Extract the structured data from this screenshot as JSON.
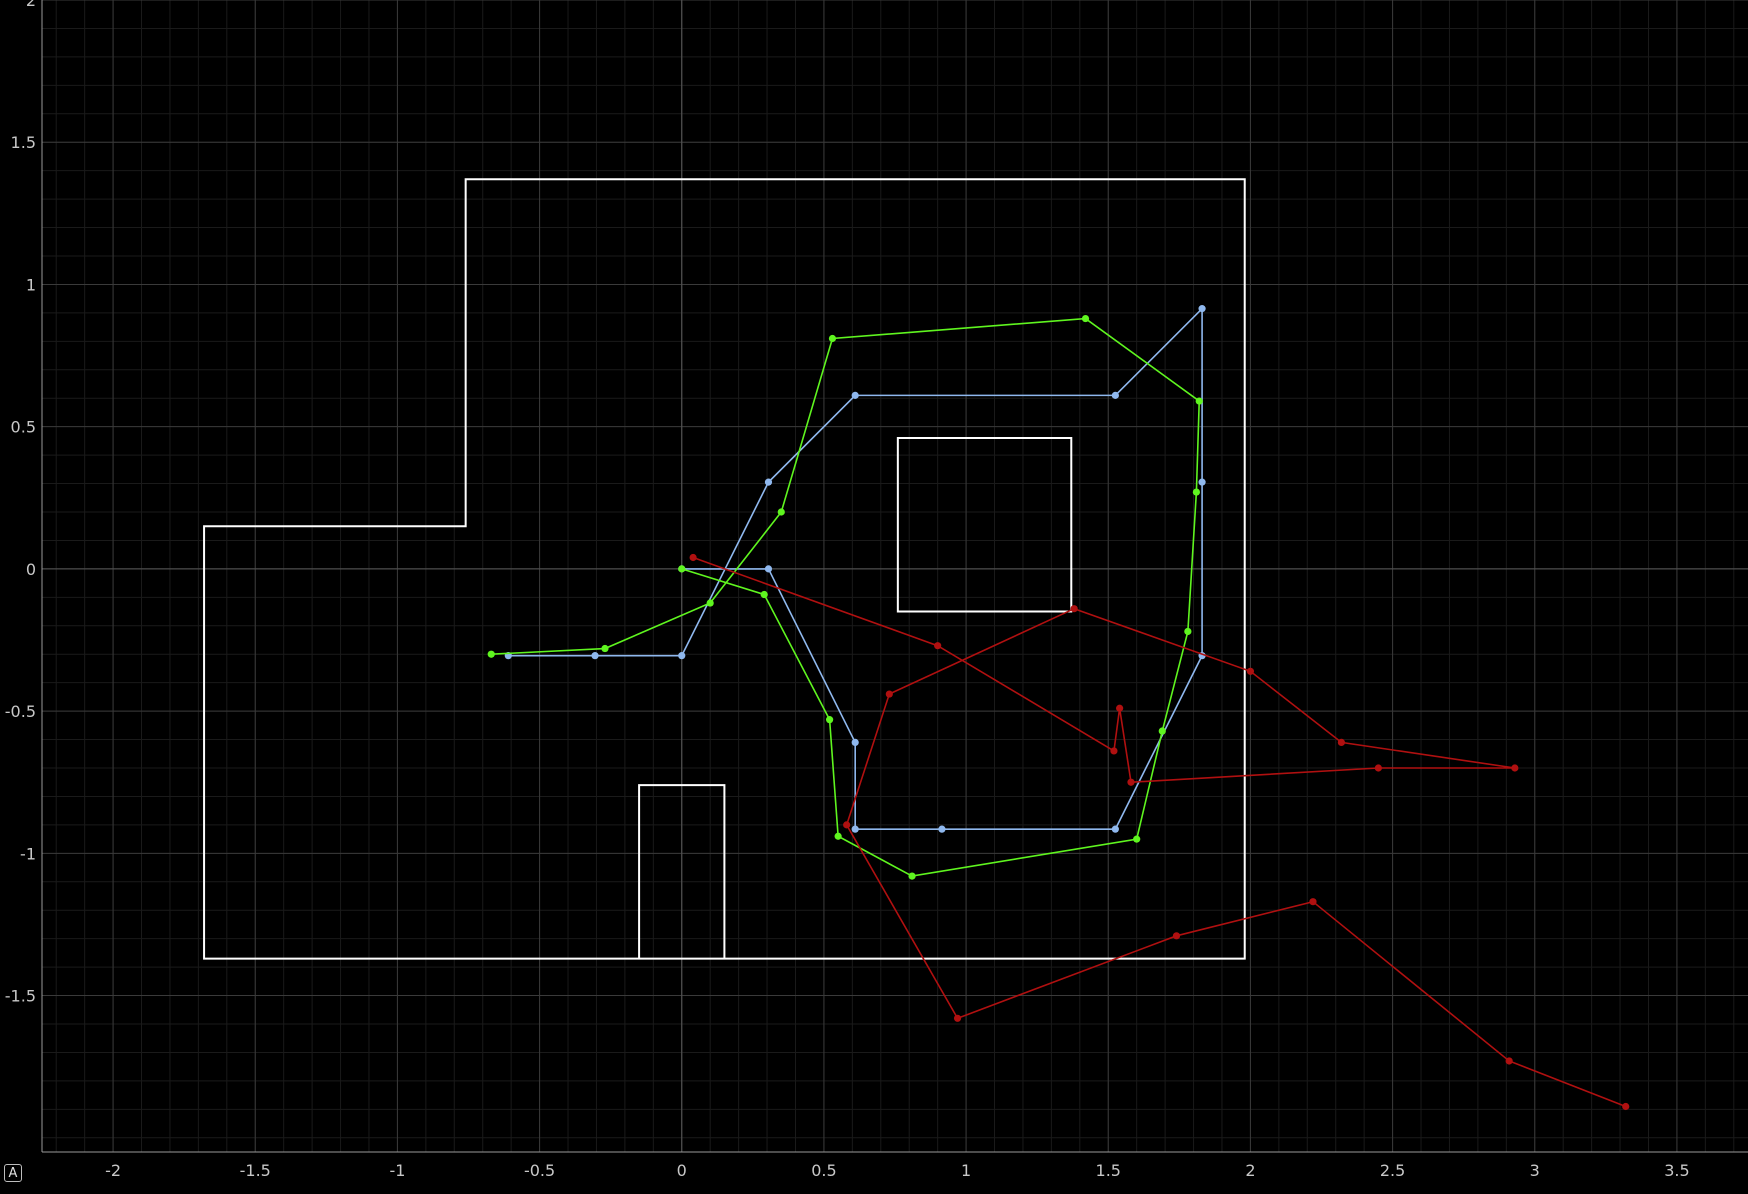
{
  "chart_data": {
    "type": "scatter",
    "xlim": [
      -2.25,
      3.75
    ],
    "ylim": [
      -2.05,
      2.0
    ],
    "x_ticks": [
      -2,
      -1.5,
      -1,
      -0.5,
      0,
      0.5,
      1,
      1.5,
      2,
      2.5,
      3,
      3.5
    ],
    "y_ticks": [
      2,
      1.5,
      1,
      0.5,
      0,
      -0.5,
      -1,
      -1.5
    ],
    "grid": true,
    "legend": "none",
    "background": "#000000",
    "map_outlines": [
      {
        "color": "#ffffff",
        "closed": true,
        "points": [
          [
            -1.68,
            -1.37
          ],
          [
            1.98,
            -1.37
          ],
          [
            1.98,
            1.37
          ],
          [
            -0.76,
            1.37
          ],
          [
            -0.76,
            0.15
          ],
          [
            -1.68,
            0.15
          ]
        ]
      },
      {
        "color": "#ffffff",
        "closed": true,
        "points": [
          [
            0.76,
            -0.15
          ],
          [
            1.37,
            -0.15
          ],
          [
            1.37,
            0.46
          ],
          [
            0.76,
            0.46
          ]
        ]
      },
      {
        "color": "#ffffff",
        "closed": false,
        "points": [
          [
            -0.15,
            -1.37
          ],
          [
            -0.15,
            -0.76
          ],
          [
            0.15,
            -0.76
          ],
          [
            0.15,
            -1.37
          ]
        ]
      }
    ],
    "series": [
      {
        "color": "#8fb8ee",
        "points": [
          [
            0,
            0
          ],
          [
            0.305,
            0
          ],
          [
            0.61,
            -0.61
          ],
          [
            0.61,
            -0.915
          ],
          [
            0.915,
            -0.915
          ],
          [
            1.525,
            -0.915
          ],
          [
            1.83,
            -0.305
          ],
          [
            1.83,
            0.305
          ],
          [
            1.83,
            0.915
          ],
          [
            1.525,
            0.61
          ],
          [
            0.61,
            0.61
          ],
          [
            0.305,
            0.305
          ],
          [
            0,
            -0.305
          ],
          [
            -0.305,
            -0.305
          ],
          [
            -0.61,
            -0.305
          ]
        ]
      },
      {
        "color": "#5ff51f",
        "points": [
          [
            0,
            0
          ],
          [
            0.29,
            -0.09
          ],
          [
            0.52,
            -0.53
          ],
          [
            0.55,
            -0.94
          ],
          [
            0.81,
            -1.08
          ],
          [
            1.6,
            -0.95
          ],
          [
            1.69,
            -0.57
          ],
          [
            1.78,
            -0.22
          ],
          [
            1.81,
            0.27
          ],
          [
            1.82,
            0.59
          ],
          [
            1.42,
            0.88
          ],
          [
            0.53,
            0.81
          ],
          [
            0.35,
            0.2
          ],
          [
            0.1,
            -0.12
          ],
          [
            -0.27,
            -0.28
          ],
          [
            -0.67,
            -0.3
          ]
        ]
      },
      {
        "color": "#b01010",
        "points": [
          [
            0.04,
            0.04
          ],
          [
            0.9,
            -0.27
          ],
          [
            1.52,
            -0.64
          ],
          [
            1.54,
            -0.49
          ],
          [
            1.58,
            -0.75
          ],
          [
            2.45,
            -0.7
          ],
          [
            2.93,
            -0.7
          ],
          [
            2.32,
            -0.61
          ],
          [
            2.0,
            -0.36
          ],
          [
            1.38,
            -0.14
          ],
          [
            0.73,
            -0.44
          ],
          [
            0.58,
            -0.9
          ],
          [
            0.97,
            -1.58
          ],
          [
            1.74,
            -1.29
          ],
          [
            2.22,
            -1.17
          ],
          [
            2.91,
            -1.73
          ],
          [
            3.32,
            -1.89
          ]
        ]
      }
    ]
  },
  "ui": {
    "corner_button_label": "A"
  }
}
